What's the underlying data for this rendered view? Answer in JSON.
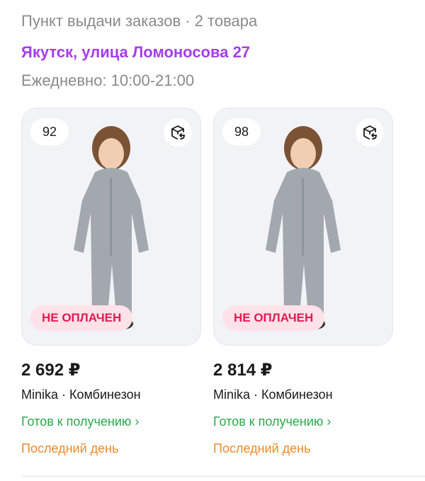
{
  "header": {
    "pickup_summary": "Пункт выдачи заказов · 2 товара",
    "address": "Якутск, улица Ломоносова 27",
    "hours": "Ежедневно: 10:00-21:00"
  },
  "items": [
    {
      "size": "92",
      "status_badge": "НЕ ОПЛАЧЕН",
      "price": "2 692 ₽",
      "title": "Minika · Комбинезон",
      "ready_label": "Готов к получению ›",
      "last_day_label": "Последний день",
      "return_icon": "box-return-icon"
    },
    {
      "size": "98",
      "status_badge": "НЕ ОПЛАЧЕН",
      "price": "2 814 ₽",
      "title": "Minika · Комбинезон",
      "ready_label": "Готов к получению ›",
      "last_day_label": "Последний день",
      "return_icon": "box-return-icon"
    }
  ],
  "colors": {
    "accent_purple": "#a63cf0",
    "status_red": "#e6194d",
    "ready_green": "#2ba84a",
    "last_day_orange": "#f08a24"
  }
}
